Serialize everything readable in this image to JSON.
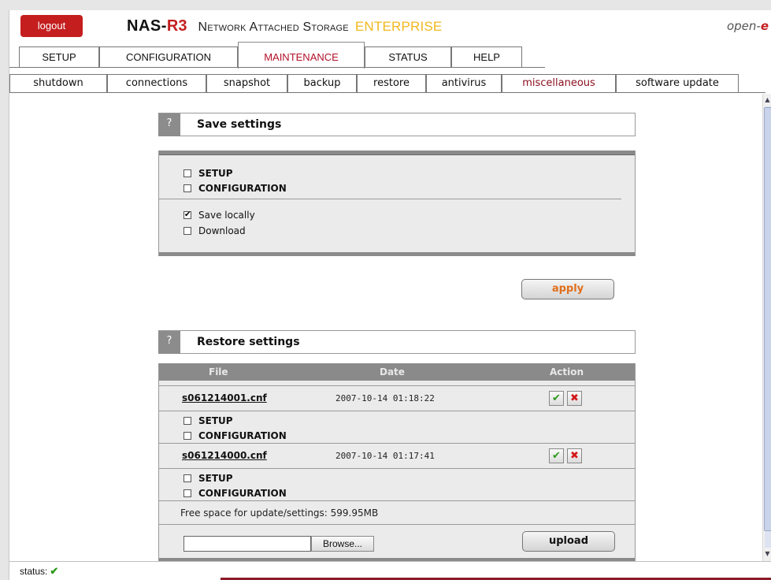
{
  "header": {
    "logout_label": "logout",
    "brand_a": "NAS-",
    "brand_b": "R3",
    "brand_subtitle": "Network Attached Storage",
    "brand_edition": "ENTERPRISE",
    "vendor_a": "open-",
    "vendor_b": "e"
  },
  "main_tabs": [
    {
      "label": "SETUP",
      "active": false
    },
    {
      "label": "CONFIGURATION",
      "active": false
    },
    {
      "label": "MAINTENANCE",
      "active": true
    },
    {
      "label": "STATUS",
      "active": false
    },
    {
      "label": "HELP",
      "active": false
    }
  ],
  "sub_tabs": [
    {
      "label": "shutdown",
      "active": false
    },
    {
      "label": "connections",
      "active": false
    },
    {
      "label": "snapshot",
      "active": false
    },
    {
      "label": "backup",
      "active": false
    },
    {
      "label": "restore",
      "active": false
    },
    {
      "label": "antivirus",
      "active": false
    },
    {
      "label": "miscellaneous",
      "active": true
    },
    {
      "label": "software update",
      "active": false
    }
  ],
  "save_settings": {
    "help_glyph": "?",
    "title": "Save settings",
    "options": [
      {
        "label": "SETUP",
        "checked": false
      },
      {
        "label": "CONFIGURATION",
        "checked": false
      }
    ],
    "targets": [
      {
        "label": "Save locally",
        "checked": true
      },
      {
        "label": "Download",
        "checked": false
      }
    ],
    "apply_label": "apply"
  },
  "restore_settings": {
    "help_glyph": "?",
    "title": "Restore settings",
    "columns": {
      "file": "File",
      "date": "Date",
      "action": "Action"
    },
    "files": [
      {
        "name": "s061214001.cnf",
        "date": "2007-10-14 01:18:22",
        "options": [
          {
            "label": "SETUP",
            "checked": false
          },
          {
            "label": "CONFIGURATION",
            "checked": false
          }
        ]
      },
      {
        "name": "s061214000.cnf",
        "date": "2007-10-14 01:17:41",
        "options": [
          {
            "label": "SETUP",
            "checked": false
          },
          {
            "label": "CONFIGURATION",
            "checked": false
          }
        ]
      }
    ],
    "free_space": "Free space for update/settings: 599.95MB",
    "file_input_value": "",
    "browse_label": "Browse...",
    "upload_label": "upload"
  },
  "status": {
    "label": "status:",
    "icon": "check-icon",
    "ok_color": "#2d9a1b"
  },
  "colors": {
    "accent_red": "#c41e1e",
    "edition_gold": "#f2b81e",
    "apply_orange": "#e06f1c"
  }
}
